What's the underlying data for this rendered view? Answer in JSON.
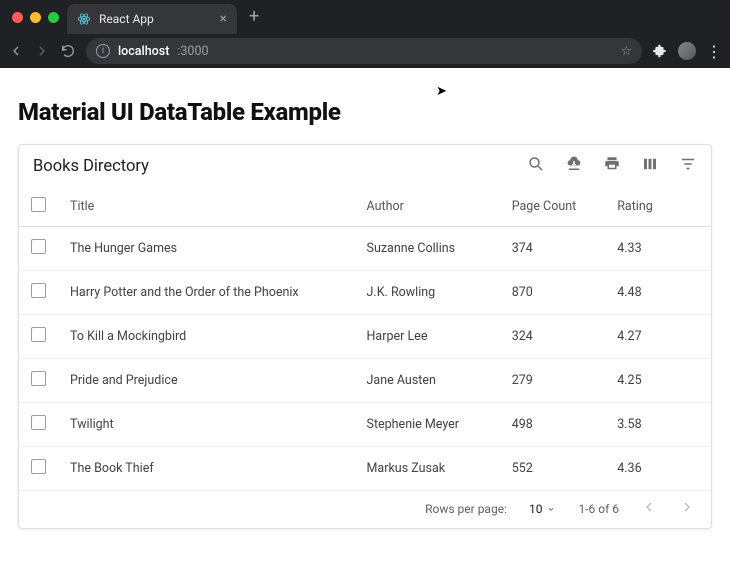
{
  "browser": {
    "tab_title": "React App",
    "url_host": "localhost",
    "url_port": ":3000"
  },
  "page": {
    "heading": "Material UI DataTable Example"
  },
  "table": {
    "title": "Books Directory",
    "columns": {
      "title": "Title",
      "author": "Author",
      "page_count": "Page Count",
      "rating": "Rating"
    },
    "rows": [
      {
        "title": "The Hunger Games",
        "author": "Suzanne Collins",
        "page_count": "374",
        "rating": "4.33"
      },
      {
        "title": "Harry Potter and the Order of the Phoenix",
        "author": "J.K. Rowling",
        "page_count": "870",
        "rating": "4.48"
      },
      {
        "title": "To Kill a Mockingbird",
        "author": "Harper Lee",
        "page_count": "324",
        "rating": "4.27"
      },
      {
        "title": "Pride and Prejudice",
        "author": "Jane Austen",
        "page_count": "279",
        "rating": "4.25"
      },
      {
        "title": "Twilight",
        "author": "Stephenie Meyer",
        "page_count": "498",
        "rating": "3.58"
      },
      {
        "title": "The Book Thief",
        "author": "Markus Zusak",
        "page_count": "552",
        "rating": "4.36"
      }
    ],
    "footer": {
      "rows_per_page_label": "Rows per page:",
      "rows_per_page_value": "10",
      "range_label": "1-6 of 6"
    }
  }
}
